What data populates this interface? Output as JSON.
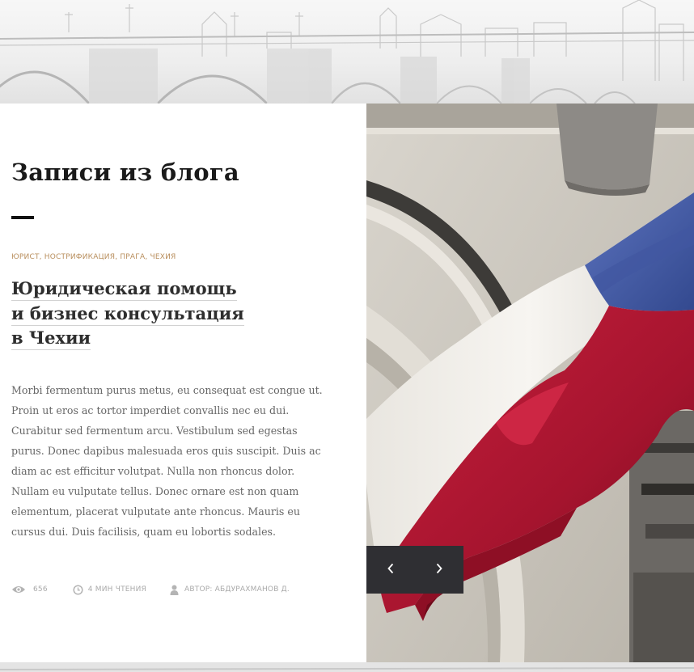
{
  "section": {
    "title": "Записи из блога"
  },
  "post": {
    "tags": [
      "ЮРИСТ",
      "НОСТРИФИКАЦИЯ",
      "ПРАГА",
      "ЧЕХИЯ"
    ],
    "title_lines": [
      "Юридическая помощь",
      "и бизнес консультация",
      "в Чехии"
    ],
    "excerpt_lines": [
      "Morbi fermentum purus metus, eu consequat est congue ut.",
      "Proin ut eros ac tortor imperdiet convallis nec eu dui.",
      "Curabitur sed fermentum arcu. Vestibulum sed egestas",
      "purus. Donec dapibus malesuada eros quis suscipit. Duis ac",
      "diam ac est efficitur volutpat. Nulla non rhoncus dolor.",
      "Nullam eu vulputate tellus. Donec ornare est non quam",
      "elementum, placerat vulputate ante rhoncus. Mauris eu",
      "cursus dui. Duis facilisis, quam eu lobortis sodales."
    ],
    "meta": {
      "views": "656",
      "read_time": "4 МИН ЧТЕНИЯ",
      "author": "АВТОР: АБДУРАХМАНОВ Д."
    }
  },
  "icons": {
    "views": "eye-icon",
    "read_time": "clock-icon",
    "author": "user-icon",
    "prev": "chevron-left-icon",
    "next": "chevron-right-icon"
  },
  "colors": {
    "tag": "#b98f5e",
    "nav_bg": "#2f2f33",
    "flag_white": "#f0eeea",
    "flag_blue": "#4a63b0",
    "flag_red": "#b31a36"
  }
}
